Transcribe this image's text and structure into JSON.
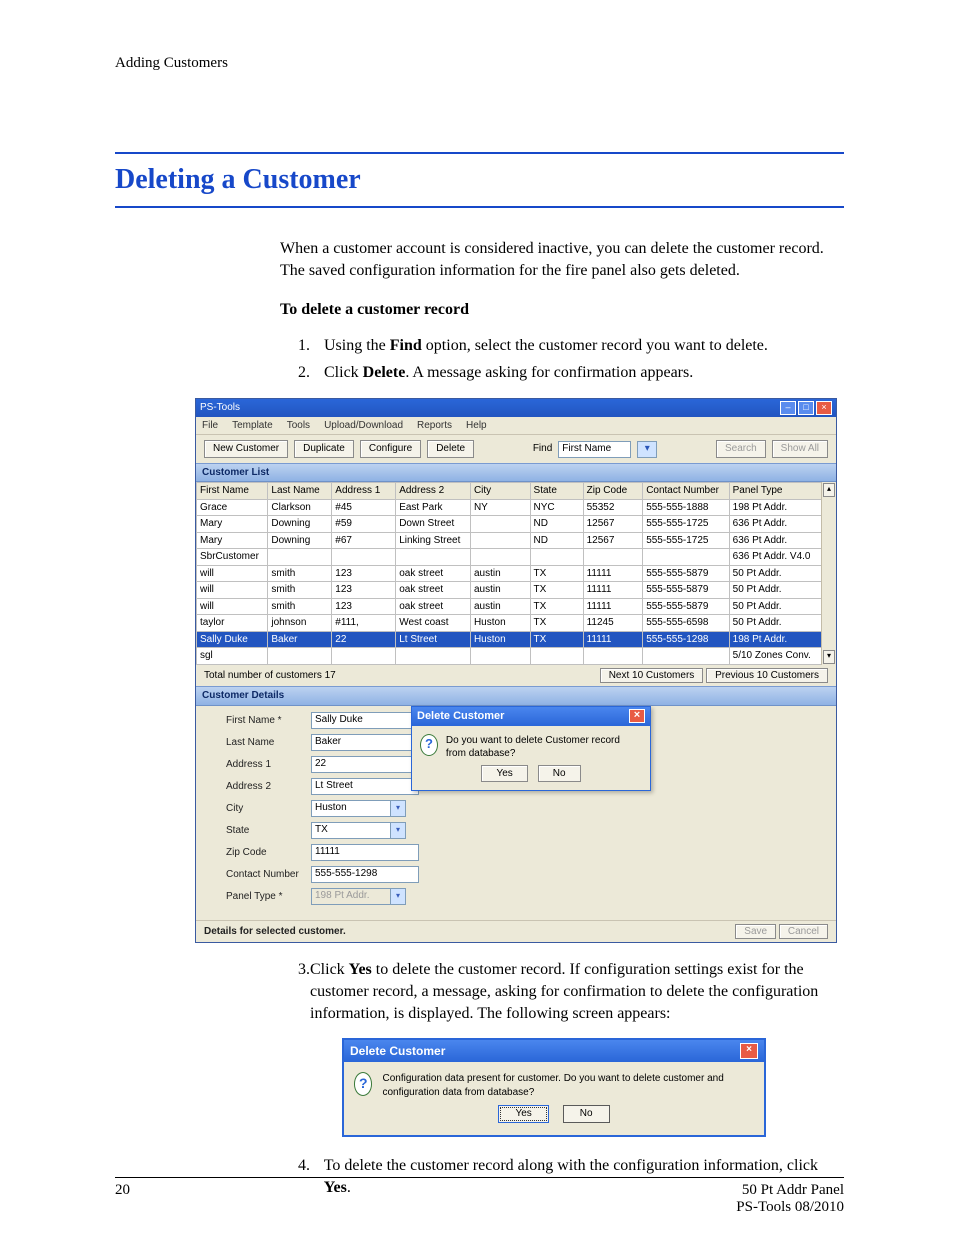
{
  "header": {
    "running_head": "Adding Customers"
  },
  "heading": "Deleting a Customer",
  "intro": "When a customer account is considered inactive, you can delete the customer record. The saved configuration information for the fire panel also gets deleted.",
  "subheading": "To delete a customer record",
  "steps_a": [
    {
      "n": "1.",
      "pre": "Using the ",
      "bold": "Find",
      "post": " option, select the customer record you want to delete."
    },
    {
      "n": "2.",
      "pre": "Click ",
      "bold": "Delete",
      "post": ". A message asking for confirmation appears."
    }
  ],
  "steps_b": [
    {
      "n": "3.",
      "pre": "Click ",
      "bold": "Yes",
      "post": " to delete the customer record. If configuration settings exist for the customer record, a message, asking for confirmation to delete the configuration information, is displayed. The following screen appears:"
    }
  ],
  "steps_c": [
    {
      "n": "4.",
      "pre": "To delete the customer record along with the configuration information, click ",
      "bold": "Yes",
      "post": "."
    }
  ],
  "screenshot1": {
    "title": "PS-Tools",
    "menus": [
      "File",
      "Template",
      "Tools",
      "Upload/Download",
      "Reports",
      "Help"
    ],
    "toolbar": {
      "new_customer": "New Customer",
      "duplicate": "Duplicate",
      "configure": "Configure",
      "delete": "Delete",
      "find_label": "Find",
      "find_value": "First Name",
      "search": "Search",
      "show_all": "Show All"
    },
    "list_title": "Customer List",
    "columns": [
      "First Name",
      "Last Name",
      "Address 1",
      "Address 2",
      "City",
      "State",
      "Zip Code",
      "Contact Number",
      "Panel Type"
    ],
    "rows": [
      [
        "Grace",
        "Clarkson",
        "#45",
        "East Park",
        "NY",
        "NYC",
        "55352",
        "555-555-1888",
        "198 Pt Addr."
      ],
      [
        "Mary",
        "Downing",
        "#59",
        "Down Street",
        "",
        "ND",
        "12567",
        "555-555-1725",
        "636 Pt Addr."
      ],
      [
        "Mary",
        "Downing",
        "#67",
        "Linking Street",
        "",
        "ND",
        "12567",
        "555-555-1725",
        "636 Pt Addr."
      ],
      [
        "SbrCustomer",
        "",
        "",
        "",
        "",
        "",
        "",
        "",
        "636 Pt Addr. V4.0"
      ],
      [
        "will",
        "smith",
        "123",
        "oak street",
        "austin",
        "TX",
        "11111",
        "555-555-5879",
        "50 Pt Addr."
      ],
      [
        "will",
        "smith",
        "123",
        "oak street",
        "austin",
        "TX",
        "11111",
        "555-555-5879",
        "50 Pt Addr."
      ],
      [
        "will",
        "smith",
        "123",
        "oak street",
        "austin",
        "TX",
        "11111",
        "555-555-5879",
        "50 Pt Addr."
      ],
      [
        "taylor",
        "johnson",
        "#111,",
        "West coast",
        "Huston",
        "TX",
        "11245",
        "555-555-6598",
        "50 Pt Addr."
      ],
      [
        "Sally Duke",
        "Baker",
        "22",
        "Lt Street",
        "Huston",
        "TX",
        "11111",
        "555-555-1298",
        "198 Pt Addr."
      ],
      [
        "sgl",
        "",
        "",
        "",
        "",
        "",
        "",
        "",
        "5/10 Zones Conv."
      ]
    ],
    "selected_row_index": 8,
    "total_label": "Total number of customers 17",
    "next_btn": "Next 10 Customers",
    "prev_btn": "Previous 10 Customers",
    "details_title": "Customer Details",
    "details": {
      "First Name *": "Sally Duke",
      "Last Name": "Baker",
      "Address 1": "22",
      "Address 2": "Lt Street",
      "City": "Huston",
      "State": "TX",
      "Zip Code": "11111",
      "Contact Number": "555-555-1298",
      "Panel Type *": "198 Pt Addr."
    },
    "dialog": {
      "title": "Delete Customer",
      "message": "Do you want to delete Customer record from database?",
      "yes": "Yes",
      "no": "No"
    },
    "footer_status": "Details for selected customer.",
    "save": "Save",
    "cancel": "Cancel"
  },
  "screenshot2": {
    "title": "Delete Customer",
    "message": "Configuration data present for customer. Do you want to delete customer and configuration data from database?",
    "yes": "Yes",
    "no": "No"
  },
  "footer": {
    "page": "20",
    "right1": "50 Pt Addr Panel",
    "right2": "PS-Tools 08/2010"
  }
}
